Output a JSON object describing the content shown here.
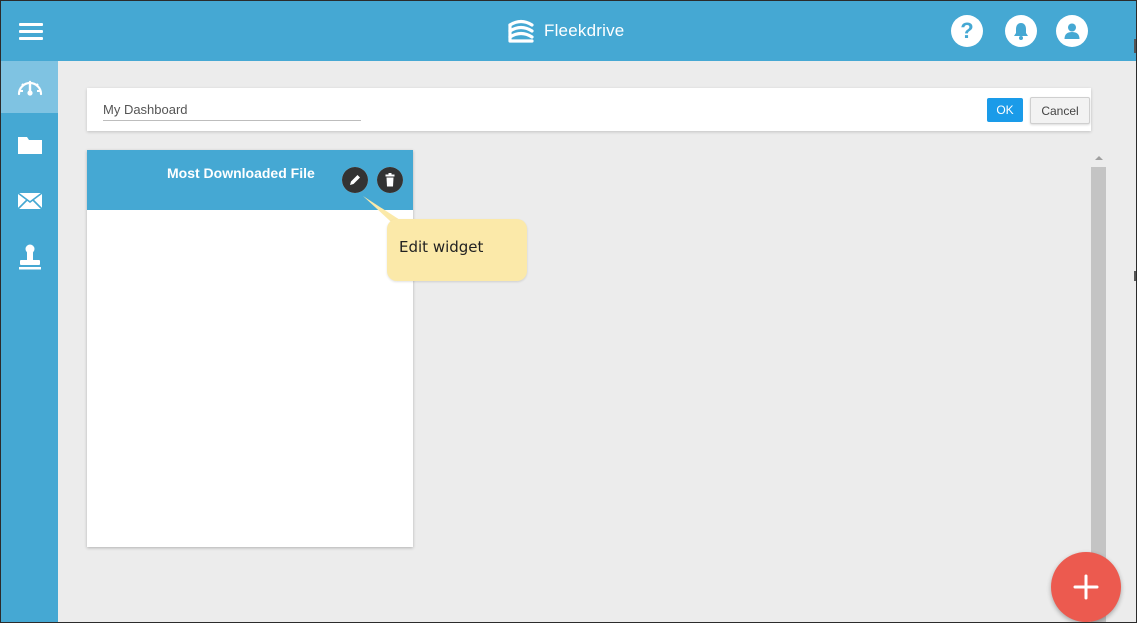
{
  "app": {
    "name": "Fleekdrive",
    "brand_color": "#45a8d3"
  },
  "topbar": {
    "menu_icon": "hamburger-menu-icon",
    "logo_icon": "fleekdrive-logo-icon",
    "help_icon": "help-icon",
    "help_glyph": "?",
    "notifications_icon": "bell-icon",
    "user_icon": "user-avatar-icon"
  },
  "sidebar": {
    "items": [
      {
        "id": "dashboard",
        "icon": "speedometer-icon",
        "active": true
      },
      {
        "id": "folders",
        "icon": "folder-icon",
        "active": false
      },
      {
        "id": "messages",
        "icon": "envelope-icon",
        "active": false
      },
      {
        "id": "workflow",
        "icon": "stamp-icon",
        "active": false
      }
    ]
  },
  "dashboard_editor": {
    "name_value": "My Dashboard",
    "ok_label": "OK",
    "cancel_label": "Cancel",
    "ok_color": "#1a9be9"
  },
  "widget": {
    "title": "Most Downloaded File",
    "edit_icon": "pencil-icon",
    "delete_icon": "trash-icon"
  },
  "tooltip": {
    "text": "Edit widget",
    "background": "#fbe9a9"
  },
  "fab": {
    "icon": "plus-icon",
    "color": "#ec5a4f"
  }
}
